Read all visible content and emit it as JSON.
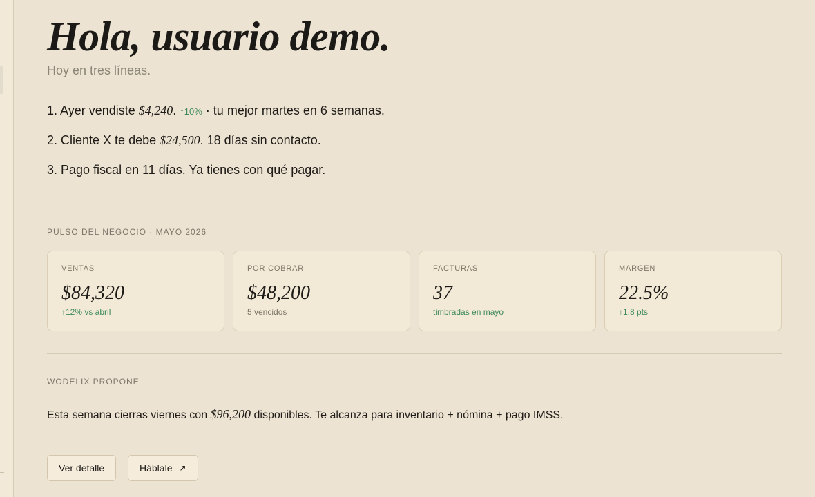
{
  "greeting": "Hola, usuario demo.",
  "subtitle": "Hoy en tres líneas.",
  "summary": {
    "line1": {
      "before": "1. Ayer vendiste ",
      "amount": "$4,240",
      "after_amount": ".",
      "delta": "↑10%",
      "after": " · tu mejor martes en 6 semanas."
    },
    "line2": {
      "before": "2. Cliente X te debe ",
      "amount": "$24,500",
      "after": ". 18 días sin contacto."
    },
    "line3": {
      "text": "3. Pago fiscal en 11 días. Ya tienes con qué pagar."
    }
  },
  "pulse": {
    "title": "PULSO DEL NEGOCIO · MAYO 2026",
    "cards": [
      {
        "label": "VENTAS",
        "value": "$84,320",
        "note": "↑12% vs abril"
      },
      {
        "label": "POR COBRAR",
        "value": "$48,200",
        "note": "5 vencidos"
      },
      {
        "label": "FACTURAS",
        "value": "37",
        "note": "timbradas en mayo"
      },
      {
        "label": "MARGEN",
        "value": "22.5%",
        "note": "↑1.8 pts"
      }
    ]
  },
  "proposal": {
    "title": "WODELIX PROPONE",
    "before": "Esta semana cierras viernes con ",
    "amount": "$96,200",
    "after": " disponibles. Te alcanza para inventario + nómina + pago IMSS.",
    "buttons": {
      "detail": "Ver detalle",
      "talk": "Háblale",
      "talk_icon": "↗"
    }
  },
  "colors": {
    "background": "#ede3d3",
    "card": "#f3e9d7",
    "positive": "#3f8a5a",
    "muted": "#7c7668"
  }
}
